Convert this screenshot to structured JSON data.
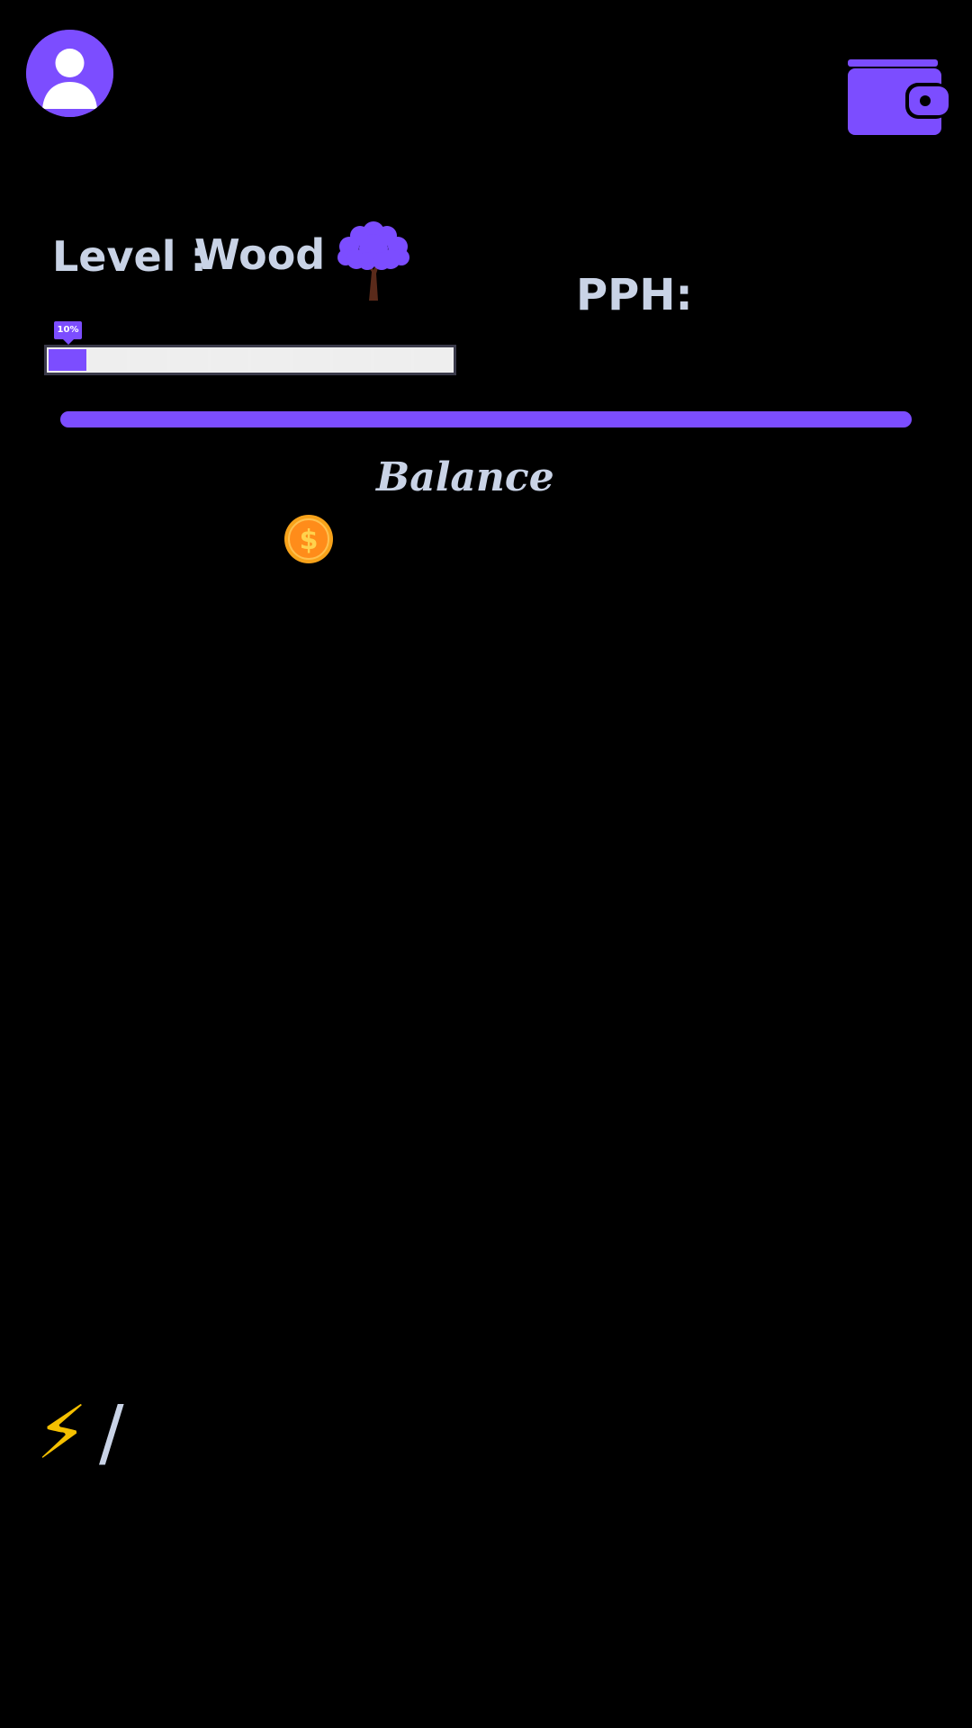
{
  "header": {
    "avatar_icon": "user-icon",
    "wallet_icon": "wallet-icon"
  },
  "level": {
    "label": "Level :",
    "value": "Wood",
    "icon": "tree-icon"
  },
  "pph": {
    "label": "PPH:"
  },
  "progress": {
    "badge": "10%",
    "fraction": 0.1,
    "segments": 10
  },
  "balance": {
    "label": "Balance",
    "icon": "coin-icon"
  },
  "energy": {
    "icon": "⚡",
    "separator": "/"
  },
  "colors": {
    "accent": "#7c4dff",
    "text": "#c9d3e6",
    "background": "#000000",
    "coin": "#f7931a",
    "energy": "#f5c000"
  }
}
